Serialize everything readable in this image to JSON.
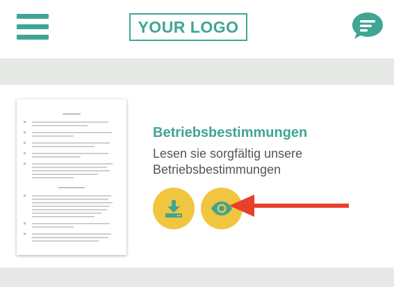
{
  "header": {
    "logo_text": "YOUR LOGO",
    "menu_icon": "hamburger-menu-icon",
    "chat_icon": "chat-bubble-icon"
  },
  "content": {
    "title": "Betriebsbestimmungen",
    "description": "Lesen sie sorgfältig unsere Betriebsbestimmungen",
    "download_icon": "download-icon",
    "view_icon": "eye-icon"
  },
  "colors": {
    "accent": "#3fa595",
    "button": "#f0c53f",
    "arrow": "#e8402a",
    "band": "#e6e8e6",
    "text": "#555555"
  }
}
